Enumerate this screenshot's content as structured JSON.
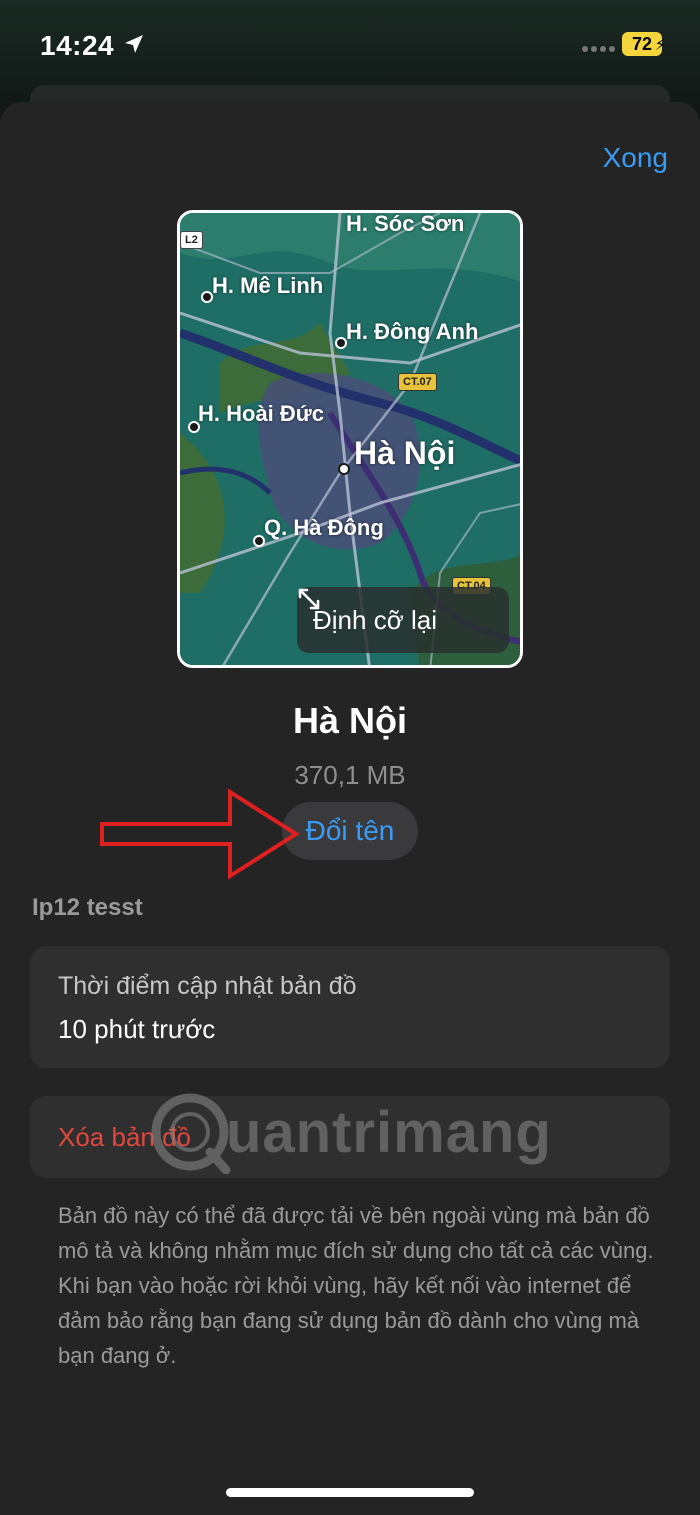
{
  "status_bar": {
    "time": "14:24",
    "battery": "72"
  },
  "header": {
    "done_label": "Xong"
  },
  "map_preview": {
    "labels": {
      "soc_son": "H. Sóc Sơn",
      "l2": "L2",
      "me_linh": "H. Mê Linh",
      "dong_anh": "H. Đông Anh",
      "ct07": "CT.07",
      "hoai_duc": "H. Hoài Đức",
      "ha_noi": "Hà Nội",
      "ha_dong": "Q. Hà Đông",
      "ct04": "CT.04"
    },
    "resize_label": "Định cỡ lại"
  },
  "region": {
    "title": "Hà Nội",
    "size": "370,1 MB",
    "rename_label": "Đổi tên"
  },
  "section": {
    "device_label": "Ip12 tesst"
  },
  "update_info": {
    "label": "Thời điểm cập nhật bản đồ",
    "value": "10 phút trước"
  },
  "delete": {
    "label": "Xóa bản đồ"
  },
  "watermark": {
    "text": "uantrimang"
  },
  "footnote": "Bản đồ này có thể đã được tải về bên ngoài vùng mà bản đồ mô tả và không nhằm mục đích sử dụng cho tất cả các vùng. Khi bạn vào hoặc rời khỏi vùng, hãy kết nối vào internet để đảm bảo rằng bạn đang sử dụng bản đồ dành cho vùng mà bạn đang ở.",
  "colors": {
    "accent": "#3a9bf4",
    "destructive": "#e0473d",
    "battery": "#f4d53b",
    "annotation_arrow": "#e02020"
  }
}
